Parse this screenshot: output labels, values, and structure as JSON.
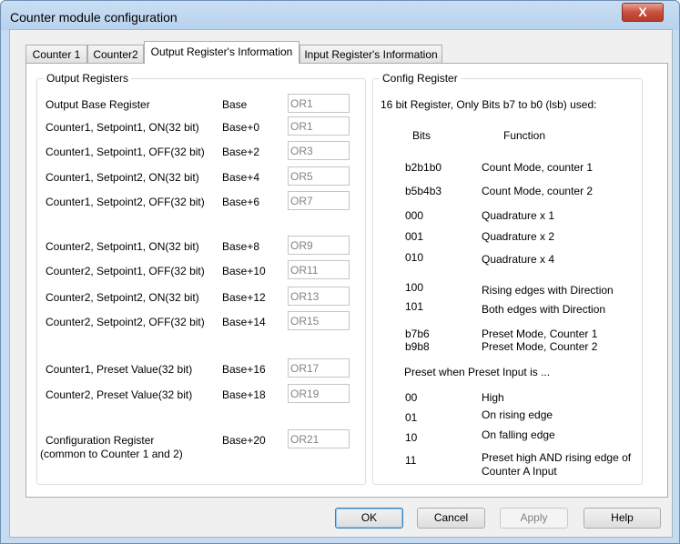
{
  "window": {
    "title": "Counter module configuration",
    "close_glyph": "X"
  },
  "tabs": [
    {
      "label": "Counter 1"
    },
    {
      "label": "Counter2"
    },
    {
      "label": "Output Register's Information"
    },
    {
      "label": "Input Register's Information"
    }
  ],
  "output_registers": {
    "title": "Output Registers",
    "rows": [
      {
        "label": "Output Base Register",
        "offset": "Base",
        "value": "OR1"
      },
      {
        "label": "Counter1, Setpoint1, ON(32 bit)",
        "offset": "Base+0",
        "value": "OR1"
      },
      {
        "label": "Counter1, Setpoint1, OFF(32 bit)",
        "offset": "Base+2",
        "value": "OR3"
      },
      {
        "label": "Counter1, Setpoint2, ON(32 bit)",
        "offset": "Base+4",
        "value": "OR5"
      },
      {
        "label": "Counter1, Setpoint2, OFF(32 bit)",
        "offset": "Base+6",
        "value": "OR7"
      },
      {
        "label": "Counter2, Setpoint1, ON(32 bit)",
        "offset": "Base+8",
        "value": "OR9"
      },
      {
        "label": "Counter2, Setpoint1, OFF(32 bit)",
        "offset": "Base+10",
        "value": "OR11"
      },
      {
        "label": "Counter2, Setpoint2, ON(32 bit)",
        "offset": "Base+12",
        "value": "OR13"
      },
      {
        "label": "Counter2, Setpoint2, OFF(32 bit)",
        "offset": "Base+14",
        "value": "OR15"
      },
      {
        "label": "Counter1, Preset Value(32 bit)",
        "offset": "Base+16",
        "value": "OR17"
      },
      {
        "label": "Counter2, Preset Value(32 bit)",
        "offset": "Base+18",
        "value": "OR19"
      },
      {
        "label": "Configuration Register",
        "offset": "Base+20",
        "value": "OR21"
      }
    ],
    "config_note": "(common to Counter 1 and 2)"
  },
  "config_register": {
    "title": "Config Register",
    "intro": "16 bit Register, Only Bits b7 to b0 (lsb) used:",
    "header_bits": "Bits",
    "header_function": "Function",
    "rows": [
      {
        "bits": "b2b1b0",
        "function": "Count Mode, counter 1"
      },
      {
        "bits": "b5b4b3",
        "function": "Count Mode, counter 2"
      },
      {
        "bits": "000",
        "function": "Quadrature x 1"
      },
      {
        "bits": "001",
        "function": "Quadrature x 2"
      },
      {
        "bits": "010",
        "function": "Quadrature x 4"
      },
      {
        "bits": "100",
        "function": "Rising edges with Direction"
      },
      {
        "bits": "101",
        "function": "Both edges with Direction"
      },
      {
        "bits": "b7b6",
        "function": "Preset Mode, Counter 1"
      },
      {
        "bits": "b9b8",
        "function": "Preset Mode, Counter 2"
      }
    ],
    "preset_note": "Preset when Preset Input is ...",
    "preset_rows": [
      {
        "bits": "00",
        "function": "High"
      },
      {
        "bits": "01",
        "function": "On rising edge"
      },
      {
        "bits": "10",
        "function": "On falling edge"
      },
      {
        "bits": "11",
        "function": "Preset high AND rising edge of",
        "function2": "Counter A Input"
      }
    ]
  },
  "buttons": {
    "ok": "OK",
    "cancel": "Cancel",
    "apply": "Apply",
    "help": "Help"
  }
}
